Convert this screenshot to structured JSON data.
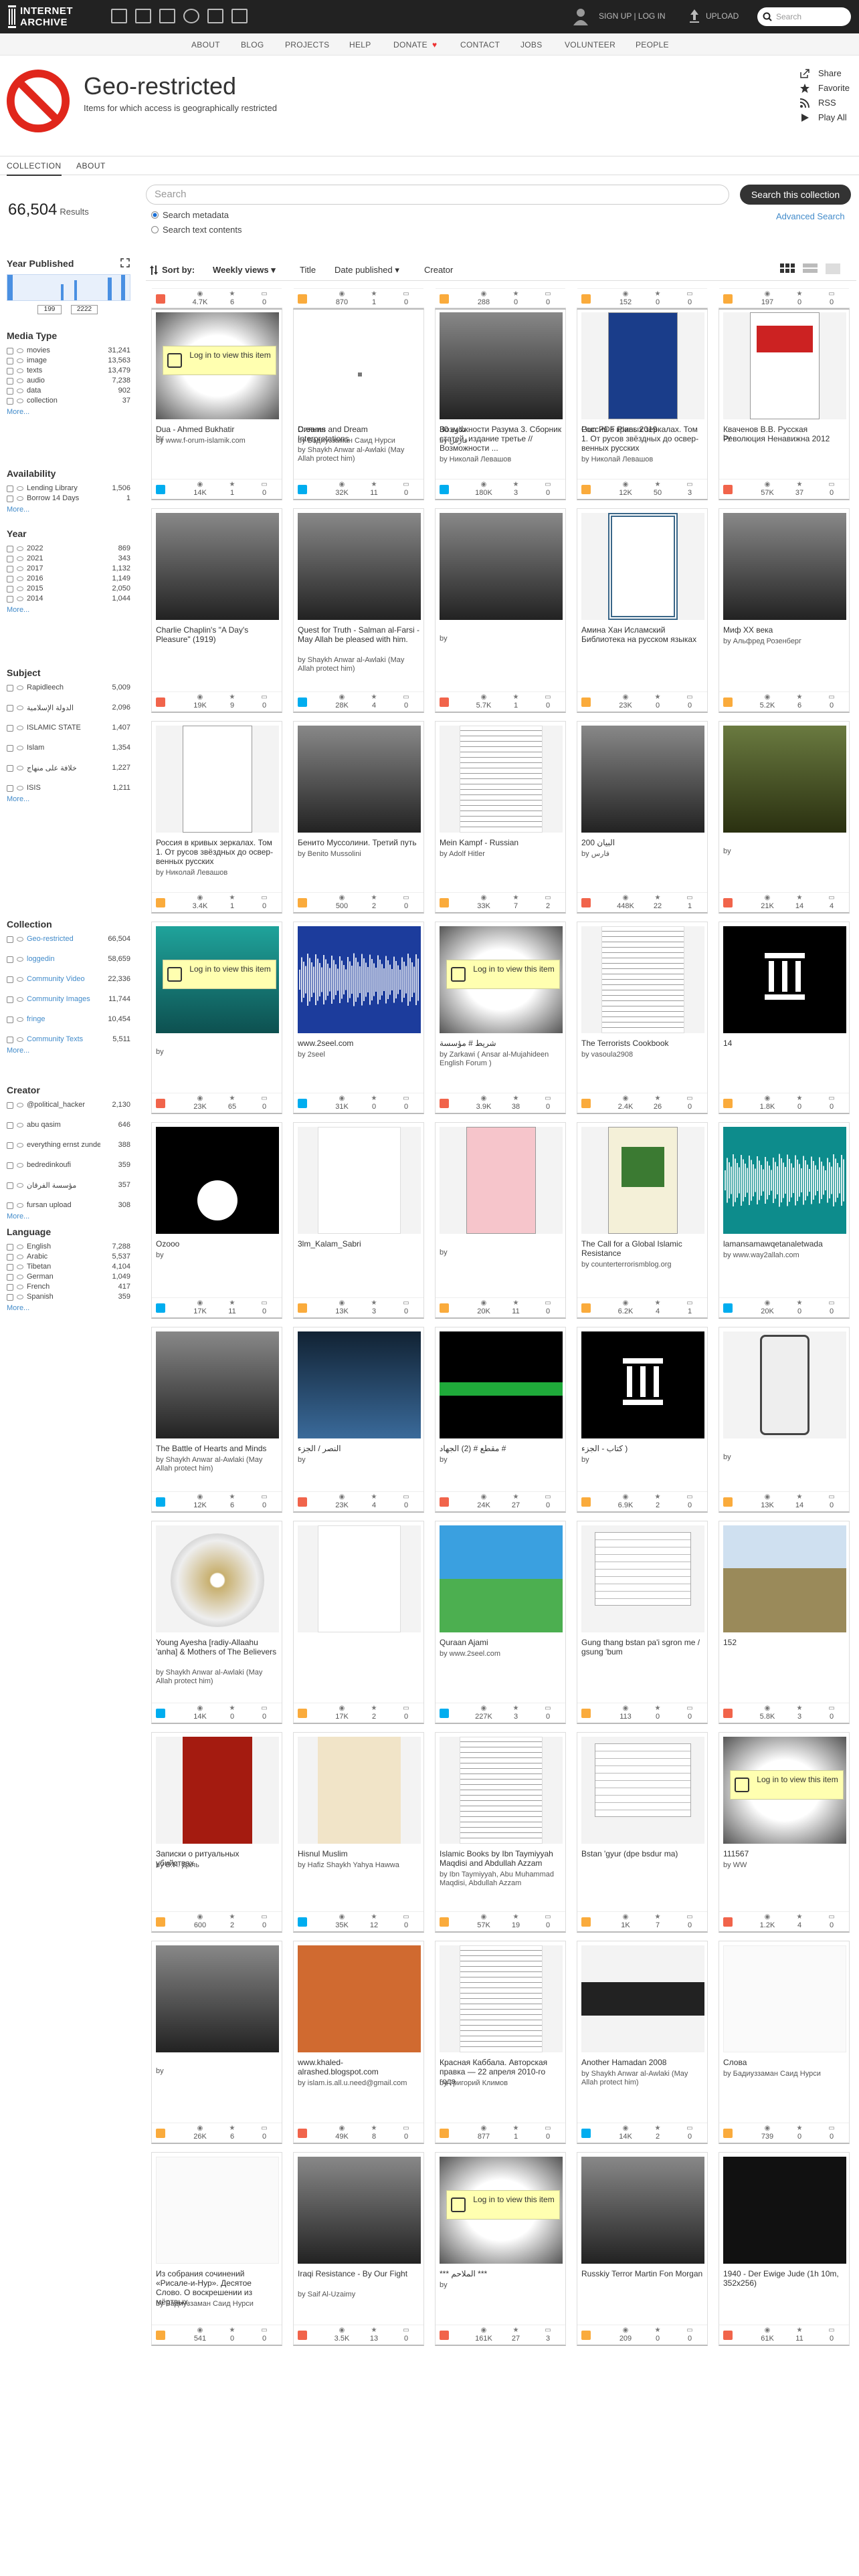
{
  "topbar": {
    "logo_line1": "INTERNET",
    "logo_line2": "ARCHIVE",
    "signup": "SIGN UP | LOG IN",
    "upload": "UPLOAD",
    "search_placeholder": "Search"
  },
  "subnav": [
    "ABOUT",
    "BLOG",
    "PROJECTS",
    "HELP",
    "DONATE",
    "CONTACT",
    "JOBS",
    "VOLUNTEER",
    "PEOPLE"
  ],
  "banner": {
    "title": "Geo-restricted",
    "subtitle": "Items for which access is geographically restricted",
    "actions": [
      "Share",
      "Favorite",
      "RSS",
      "Play All"
    ]
  },
  "tabs": [
    "COLLECTION",
    "ABOUT"
  ],
  "results": {
    "count": "66,504",
    "label": "Results"
  },
  "search": {
    "placeholder": "Search",
    "button": "Search this collection",
    "metadata": "Search metadata",
    "text": "Search text contents",
    "advanced": "Advanced Search"
  },
  "sort": {
    "label": "Sort by:",
    "options": [
      "Weekly views",
      "Title",
      "Date published",
      "Creator"
    ]
  },
  "sidebar": {
    "year_published": {
      "title": "Year Published",
      "from": "199",
      "to": "2222"
    },
    "facets": [
      {
        "title": "Media Type",
        "rows": [
          [
            "movies",
            "31,241"
          ],
          [
            "image",
            "13,563"
          ],
          [
            "texts",
            "13,479"
          ],
          [
            "audio",
            "7,238"
          ],
          [
            "data",
            "902"
          ],
          [
            "collection",
            "37"
          ]
        ]
      },
      {
        "title": "Availability",
        "rows": [
          [
            "Lending Library",
            "1,506"
          ],
          [
            "Borrow 14 Days",
            "1"
          ]
        ]
      },
      {
        "title": "Year",
        "rows": [
          [
            "2022",
            "869"
          ],
          [
            "2021",
            "343"
          ],
          [
            "2017",
            "1,132"
          ],
          [
            "2016",
            "1,149"
          ],
          [
            "2015",
            "2,050"
          ],
          [
            "2014",
            "1,044"
          ]
        ]
      },
      {
        "title": "Subject",
        "rows": [
          [
            "Rapidleech",
            "5,009"
          ],
          [
            "ﺍﻟﺪﻭﻟﺔ ﺍﻹﺳﻼﻣﻴﺔ",
            "2,096"
          ],
          [
            "ISLAMIC STATE",
            "1,407"
          ],
          [
            "Islam",
            "1,354"
          ],
          [
            "ﺧﻼﻓﺔ ﻋﻠﻰ ﻣﻨﻬﺎﺝ",
            "1,227"
          ],
          [
            "ISIS",
            "1,211"
          ]
        ]
      },
      {
        "title": "Collection",
        "rows": [
          [
            "Geo-restricted",
            "66,504"
          ],
          [
            "loggedin",
            "58,659"
          ],
          [
            "Community Video",
            "22,336"
          ],
          [
            "Community Images",
            "11,744"
          ],
          [
            "fringe",
            "10,454"
          ],
          [
            "Community Texts",
            "5,511"
          ]
        ]
      },
      {
        "title": "Creator",
        "rows": [
          [
            "@political_hacker",
            "2,130"
          ],
          [
            "abu qasim",
            "646"
          ],
          [
            "everything ernst zundel",
            "388"
          ],
          [
            "bedredinkoufi",
            "359"
          ],
          [
            "ﻣﺆﺳﺴﺔ ﺍﻟﻔﺮﻗﺎﻥ",
            "357"
          ],
          [
            "fursan upload",
            "308"
          ]
        ]
      },
      {
        "title": "Language",
        "rows": [
          [
            "English",
            "7,288"
          ],
          [
            "Arabic",
            "5,537"
          ],
          [
            "Tibetan",
            "4,104"
          ],
          [
            "German",
            "1,049"
          ],
          [
            "French",
            "417"
          ],
          [
            "Spanish",
            "359"
          ]
        ]
      }
    ],
    "more": "More..."
  },
  "login_text": "Log in to view this item",
  "items": [
    {
      "title": "Dua - Ahmed Bukhatir",
      "by": "by www.f-orum-islamik.com",
      "views": "14K",
      "favs": "1",
      "reviews": "0",
      "type": "audio",
      "thumb": "wave-pink"
    },
    {
      "title": "Dreams and Dream Interpretations",
      "by": "by Shaykh Anwar al-Awlaki (May Allah protect him)",
      "views": "32K",
      "favs": "11",
      "reviews": "0",
      "type": "audio",
      "thumb": "book-dark"
    },
    {
      "title": "ﺗﻼﻭﺓ 30",
      "by": "by ﻓﺎﺭﺱ",
      "views": "180K",
      "favs": "3",
      "reviews": "0",
      "type": "audio",
      "thumb": "wave-pink"
    },
    {
      "title": "Gun PDF Plans 2019",
      "by": "",
      "views": "12K",
      "favs": "50",
      "reviews": "3",
      "type": "texts",
      "thumb": "collage"
    },
    {
      "title": "",
      "by": "by",
      "views": "57K",
      "favs": "37",
      "reviews": "0",
      "type": "movies",
      "thumb": "login"
    },
    {
      "title": "Charlie Chaplin's \"A Day's Pleasure\" (1919)",
      "by": "",
      "views": "19K",
      "favs": "9",
      "reviews": "0",
      "type": "movies",
      "thumb": "bw-car"
    },
    {
      "title": "Quest for Truth - Salman al-Farsi - May Allah be pleased with him.",
      "by": "by Shaykh Anwar al-Awlaki (May Allah protect him)",
      "views": "28K",
      "favs": "4",
      "reviews": "0",
      "type": "audio",
      "thumb": "night"
    },
    {
      "title": "",
      "by": "by",
      "views": "5.7K",
      "favs": "1",
      "reviews": "0",
      "type": "movies",
      "thumb": "dark-brown"
    },
    {
      "title": "Амина Хан Исламский Библиотека на русском языках",
      "by": "",
      "views": "23K",
      "favs": "0",
      "reviews": "0",
      "type": "texts",
      "thumb": "certificate"
    },
    {
      "title": "Миф XX века",
      "by": "by Альфред Розенберг",
      "views": "5.2K",
      "favs": "6",
      "reviews": "0",
      "type": "texts",
      "thumb": "portrait-page"
    },
    {
      "title": "Россия в кривых зеркалах. Том 1. От русов звёздных до ос­вер­венных русских",
      "by": "by Николай Левашов",
      "views": "3.4K",
      "favs": "1",
      "reviews": "0",
      "type": "texts",
      "thumb": "white-book"
    },
    {
      "title": "Бенито Муссолини. Третий путь",
      "by": "by Benito Mussolini",
      "views": "500",
      "favs": "2",
      "reviews": "0",
      "type": "texts",
      "thumb": "bw-portrait"
    },
    {
      "title": "Mein Kampf - Russian",
      "by": "by Adolf Hitler",
      "views": "33K",
      "favs": "7",
      "reviews": "2",
      "type": "texts",
      "thumb": "text-page"
    },
    {
      "title": "ﺍﻟﺒﻴﺎﻥ 200",
      "by": "by ﻓﺎﺭﺱ",
      "views": "448K",
      "favs": "22",
      "reviews": "1",
      "type": "movies",
      "thumb": "grey-scene"
    },
    {
      "title": "",
      "by": "by",
      "views": "21K",
      "favs": "14",
      "reviews": "4",
      "type": "movies",
      "thumb": "green-scene"
    },
    {
      "title": "",
      "by": "by",
      "views": "23K",
      "favs": "65",
      "reviews": "0",
      "type": "movies",
      "thumb": "login-teal"
    },
    {
      "title": "www.2seel.com",
      "by": "by 2seel",
      "views": "31K",
      "favs": "0",
      "reviews": "0",
      "type": "audio",
      "thumb": "wave-blue"
    },
    {
      "title": "ﺷﺮﻳﻂ # ﻣﺆﺳﺴﺔ",
      "by": "by Zarkawi ( Ansar al-Mujahideen English Forum )",
      "views": "3.9K",
      "favs": "38",
      "reviews": "0",
      "type": "movies",
      "thumb": "login"
    },
    {
      "title": "The Terrorists Cookbook",
      "by": "by vasoula2908",
      "views": "2.4K",
      "favs": "26",
      "reviews": "0",
      "type": "texts",
      "thumb": "text-page"
    },
    {
      "title": "14",
      "by": "",
      "views": "1.8K",
      "favs": "0",
      "reviews": "0",
      "type": "texts",
      "thumb": "pillar"
    },
    {
      "title": "Ozooo",
      "by": "by",
      "views": "17K",
      "favs": "11",
      "reviews": "0",
      "type": "audio",
      "thumb": "flag"
    },
    {
      "title": "3lm_Kalam_Sabri",
      "by": "",
      "views": "13K",
      "favs": "3",
      "reviews": "0",
      "type": "texts",
      "thumb": "arabic-page"
    },
    {
      "title": "",
      "by": "by",
      "views": "20K",
      "favs": "11",
      "reviews": "0",
      "type": "texts",
      "thumb": "red-book"
    },
    {
      "title": "The Call for a Global Islamic Resistance",
      "by": "by counterterrorismblog.org",
      "views": "6.2K",
      "favs": "4",
      "reviews": "1",
      "type": "texts",
      "thumb": "green-book"
    },
    {
      "title": "lamansamawqetanaletwada",
      "by": "by www.way2allah.com",
      "views": "20K",
      "favs": "0",
      "reviews": "0",
      "type": "audio",
      "thumb": "wave-teal"
    },
    {
      "title": "The Battle of Hearts and Minds",
      "by": "by Shaykh Anwar al-Awlaki (May Allah protect him)",
      "views": "12K",
      "favs": "6",
      "reviews": "0",
      "type": "audio",
      "thumb": "brown-poster"
    },
    {
      "title": "ﺍﻟﻨﺼﺮ / ﺍﻟﺠﺰﺀ",
      "by": "by",
      "views": "23K",
      "favs": "4",
      "reviews": "0",
      "type": "movies",
      "thumb": "blue-video"
    },
    {
      "title": "ﻣﻘﻄﻊ # (2) ﺍﻟﺠﻬﺎﺩ #",
      "by": "by",
      "views": "24K",
      "favs": "27",
      "reviews": "0",
      "type": "movies",
      "thumb": "green-bar"
    },
    {
      "title": "ﻛﺘﺎﺏ - ﺍﻟﺠﺰﺀ )",
      "by": "by",
      "views": "6.9K",
      "favs": "2",
      "reviews": "0",
      "type": "texts",
      "thumb": "pillar"
    },
    {
      "title": "",
      "by": "by",
      "views": "13K",
      "favs": "14",
      "reviews": "0",
      "type": "texts",
      "thumb": "phone"
    },
    {
      "title": "Young Ayesha [radiy-Allaahu 'anha] & Mothers of The Believers",
      "by": "by Shaykh Anwar al-Awlaki (May Allah protect him)",
      "views": "14K",
      "favs": "0",
      "reviews": "0",
      "type": "audio",
      "thumb": "cd"
    },
    {
      "title": "",
      "by": "",
      "views": "17K",
      "favs": "2",
      "reviews": "0",
      "type": "texts",
      "thumb": "green-page"
    },
    {
      "title": "Quraan Ajami",
      "by": "by www.2seel.com",
      "views": "227K",
      "favs": "3",
      "reviews": "0",
      "type": "audio",
      "thumb": "mosque"
    },
    {
      "title": "Gung thang bstan pa'i sgron me / gsung 'bum",
      "by": "",
      "views": "113",
      "favs": "0",
      "reviews": "0",
      "type": "texts",
      "thumb": "form"
    },
    {
      "title": "152",
      "by": "",
      "views": "5.8K",
      "favs": "3",
      "reviews": "0",
      "type": "movies",
      "thumb": "field"
    },
    {
      "title": "Записки о ритуальных убийствах",
      "by": "by В.И. Даль",
      "views": "600",
      "favs": "2",
      "reviews": "0",
      "type": "texts",
      "thumb": "red-cover"
    },
    {
      "title": "Hisnul Muslim",
      "by": "by Hafiz Shaykh Yahya Hawwa",
      "views": "35K",
      "favs": "12",
      "reviews": "0",
      "type": "audio",
      "thumb": "hisnul"
    },
    {
      "title": "Islamic Books by Ibn Taymiyyah Maqdisi and Abdullah Azzam",
      "by": "by Ibn Taymiyyah, Abu Muhammad Maqdisi, Abdullah Azzam",
      "views": "57K",
      "favs": "19",
      "reviews": "0",
      "type": "texts",
      "thumb": "text-page"
    },
    {
      "title": "Bstan 'gyur (dpe bsdur ma)",
      "by": "",
      "views": "1K",
      "favs": "7",
      "reviews": "0",
      "type": "texts",
      "thumb": "form"
    },
    {
      "title": "111567",
      "by": "by WW",
      "views": "1.2K",
      "favs": "4",
      "reviews": "0",
      "type": "movies",
      "thumb": "login"
    },
    {
      "title": "",
      "by": "by",
      "views": "26K",
      "favs": "6",
      "reviews": "0",
      "type": "texts",
      "thumb": "brown-arabic"
    },
    {
      "title": "www.khaled-alrashed.blogspot.com",
      "by": "by islam.is.all.u.need@gmail.com",
      "views": "49K",
      "favs": "8",
      "reviews": "0",
      "type": "movies",
      "thumb": "speaker"
    },
    {
      "title": "Красная Каббала. Авторская правка — 22 апреля 2010-го года",
      "by": "by Григорий Климов",
      "views": "877",
      "favs": "1",
      "reviews": "0",
      "type": "texts",
      "thumb": "text-page"
    },
    {
      "title": "Another Hamadan 2008",
      "by": "by Shaykh Anwar al-Awlaki (May Allah protect him)",
      "views": "14K",
      "favs": "2",
      "reviews": "0",
      "type": "audio",
      "thumb": "another"
    },
    {
      "title": "Слова",
      "by": "by Бадиуззаман Саид Нурси",
      "views": "739",
      "favs": "0",
      "reviews": "0",
      "type": "texts",
      "thumb": "blank"
    },
    {
      "title": "Из собрания сочинений «Рисале-и-Нур». Десятое Слово. О воскрешении из мёртвых",
      "by": "by Бадиуззаман Саид Нурси",
      "views": "541",
      "favs": "0",
      "reviews": "0",
      "type": "texts",
      "thumb": "blank"
    },
    {
      "title": "Iraqi Resistance - By Our Fight",
      "by": "by Saif Al-Uzaimy",
      "views": "3.5K",
      "favs": "13",
      "reviews": "0",
      "type": "movies",
      "thumb": "iraq"
    },
    {
      "title": "*** ﺍﻟﻤﻼﺣﻢ ***",
      "by": "by",
      "views": "161K",
      "favs": "27",
      "reviews": "3",
      "type": "movies",
      "thumb": "login"
    },
    {
      "title": "Russkiy Terror Martin Fon Morgan",
      "by": "",
      "views": "209",
      "favs": "0",
      "reviews": "0",
      "type": "texts",
      "thumb": "russian-terror"
    },
    {
      "title": "1940 - Der Ewige Jude (1h 10m, 352x256)",
      "by": "",
      "views": "61K",
      "favs": "11",
      "reviews": "0",
      "type": "movies",
      "thumb": "german-text"
    },
    {
      "title": "",
      "by": "by",
      "views": "4.7K",
      "favs": "6",
      "reviews": "0",
      "type": "movies",
      "thumb": "login"
    },
    {
      "title": "Сияния",
      "by": "by Бадиуззаман Саид Нурси",
      "views": "870",
      "favs": "1",
      "reviews": "0",
      "type": "texts",
      "thumb": "blank-dot"
    },
    {
      "title": "Возможности Разума 3. Сборник статей, издание третье // Возможности ...",
      "by": "by Николай Левашов",
      "views": "288",
      "favs": "0",
      "reviews": "0",
      "type": "texts",
      "thumb": "cursive"
    },
    {
      "title": "Россия в кривых зеркалах. Том 1. От русов звёздных до ос­вер­венных русских",
      "by": "by Николай Левашов",
      "views": "152",
      "favs": "0",
      "reviews": "0",
      "type": "texts",
      "thumb": "russia-blue"
    },
    {
      "title": "Кваченов В.В. Русская Революция Ненавижна 2012",
      "by": "",
      "views": "197",
      "favs": "0",
      "reviews": "0",
      "type": "texts",
      "thumb": "revolution"
    }
  ],
  "colors": {
    "audio": "#00adef",
    "texts": "#faab3c",
    "movies": "#f1644b",
    "accent": "#428bca"
  }
}
